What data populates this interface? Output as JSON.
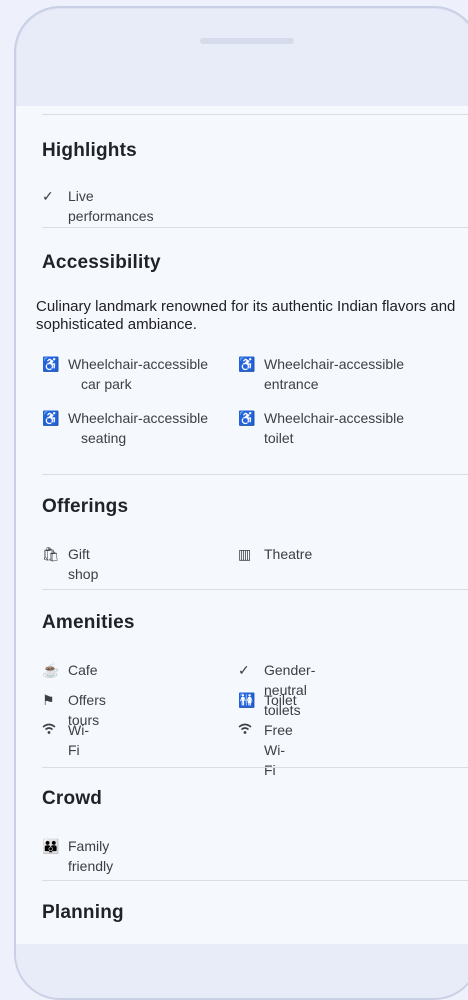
{
  "highlights": {
    "title": "Highlights",
    "items": [
      {
        "icon": "check-icon",
        "label": "Live performances"
      }
    ]
  },
  "accessibility": {
    "title": "Accessibility",
    "description": "Culinary landmark renowned for its authentic Indian flavors and sophisticated ambiance.",
    "items": [
      {
        "icon": "wheelchair-icon",
        "line1": "Wheelchair-accessible",
        "line2": "car park"
      },
      {
        "icon": "wheelchair-icon",
        "line1": "Wheelchair-accessible",
        "line2": "entrance"
      },
      {
        "icon": "wheelchair-icon",
        "line1": "Wheelchair-accessible",
        "line2": "seating"
      },
      {
        "icon": "wheelchair-icon",
        "line1": "Wheelchair-accessible",
        "line2": "toilet"
      }
    ]
  },
  "offerings": {
    "title": "Offerings",
    "items": [
      {
        "icon": "shopping-bag-icon",
        "label": "Gift shop"
      },
      {
        "icon": "theatre-icon",
        "label": "Theatre"
      }
    ]
  },
  "amenities": {
    "title": "Amenities",
    "items": [
      {
        "icon": "cafe-icon",
        "label": "Cafe"
      },
      {
        "icon": "check-icon",
        "label": "Gender-neutral toilets"
      },
      {
        "icon": "flag-icon",
        "label": "Offers tours"
      },
      {
        "icon": "toilet-icon",
        "label": "Toilet"
      },
      {
        "icon": "wifi-icon",
        "label": "Wi-Fi"
      },
      {
        "icon": "wifi-icon",
        "label": "Free Wi-Fi"
      }
    ]
  },
  "crowd": {
    "title": "Crowd",
    "items": [
      {
        "icon": "family-icon",
        "label": "Family friendly"
      }
    ]
  },
  "planning": {
    "title": "Planning"
  }
}
